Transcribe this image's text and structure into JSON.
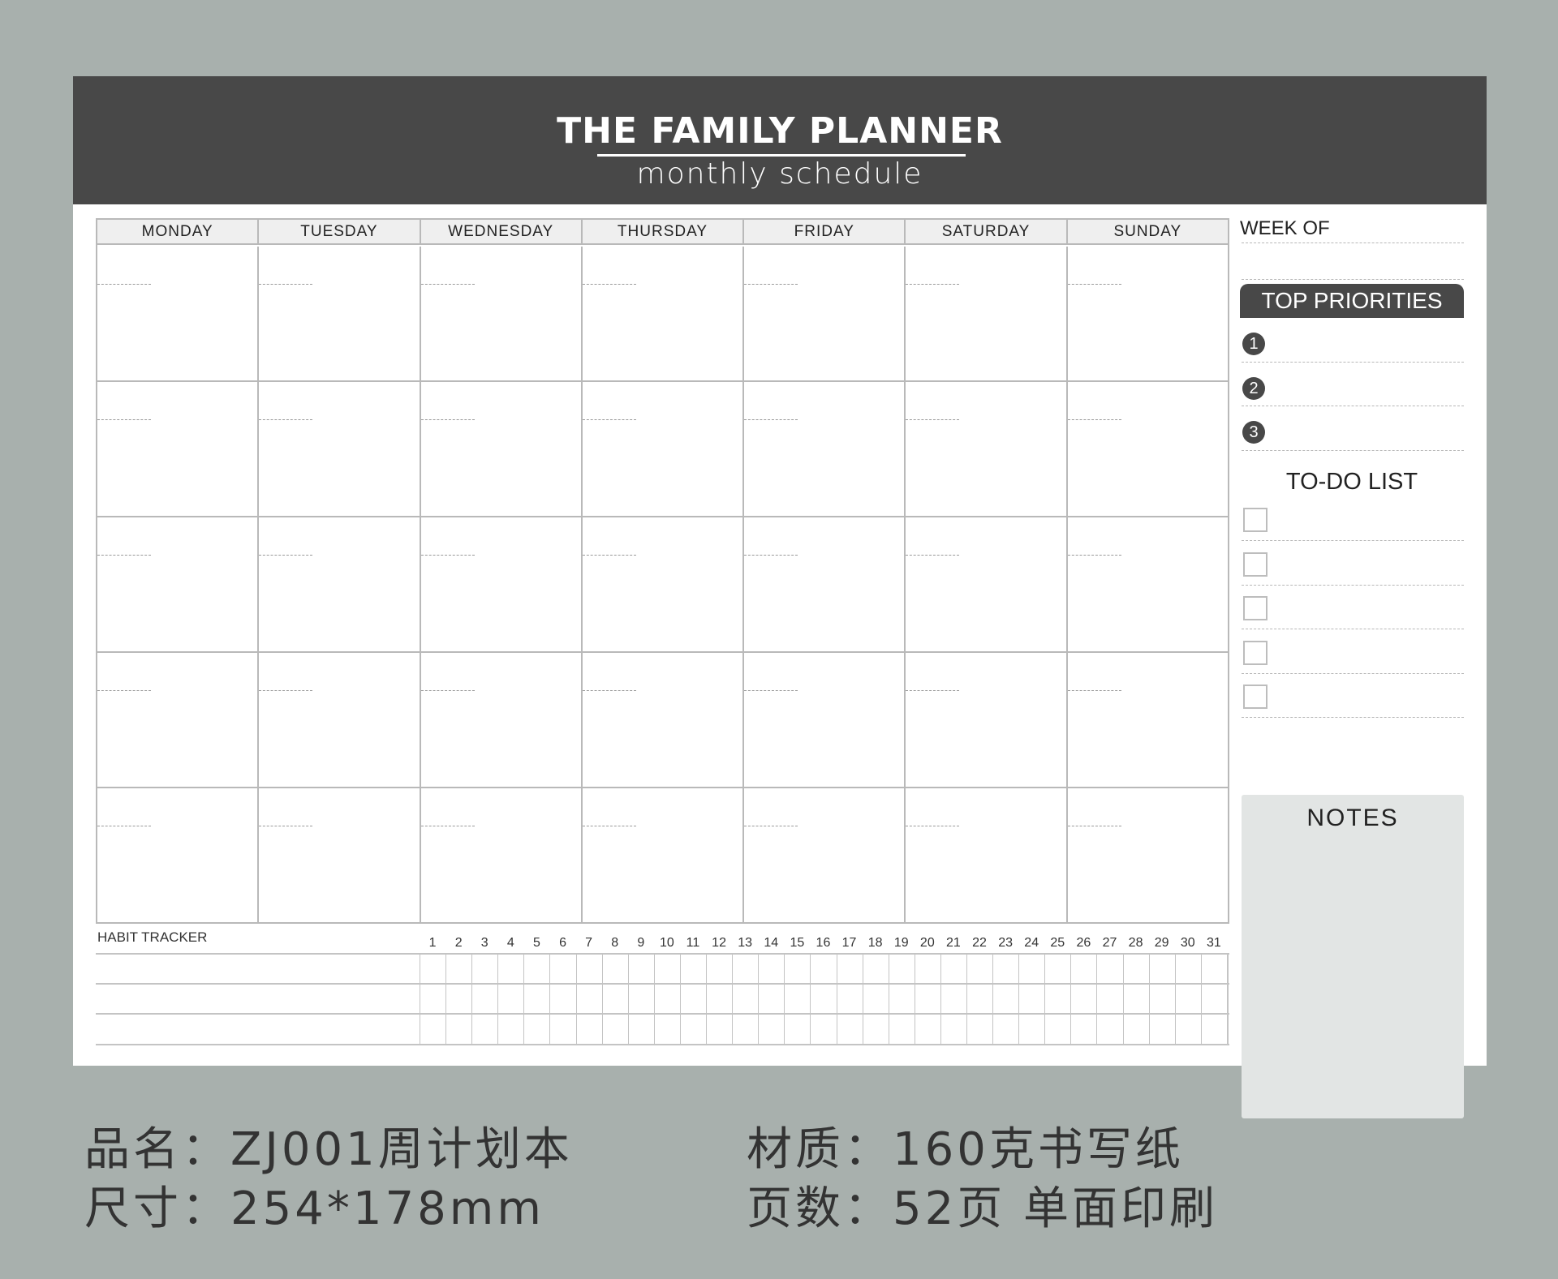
{
  "header": {
    "title": "THE FAMILY PLANNER",
    "subtitle": "monthly schedule",
    "band_color": "#484848"
  },
  "calendar": {
    "days": [
      "MONDAY",
      "TUESDAY",
      "WEDNESDAY",
      "THURSDAY",
      "FRIDAY",
      "SATURDAY",
      "SUNDAY"
    ],
    "weeks": 5
  },
  "habit_tracker": {
    "label": "HABIT TRACKER",
    "days": [
      "1",
      "2",
      "3",
      "4",
      "5",
      "6",
      "7",
      "8",
      "9",
      "10",
      "11",
      "12",
      "13",
      "14",
      "15",
      "16",
      "17",
      "18",
      "19",
      "20",
      "21",
      "22",
      "23",
      "24",
      "25",
      "26",
      "27",
      "28",
      "29",
      "30",
      "31"
    ],
    "rows": 3
  },
  "sidebar": {
    "week_of": "WEEK OF",
    "top_priorities": "TOP PRIORITIES",
    "priorities": [
      "1",
      "2",
      "3"
    ],
    "todo_title": "TO-DO LIST",
    "todo_count": 5,
    "notes_title": "NOTES"
  },
  "specs": {
    "name": "品名：ZJ001周计划本",
    "size": "尺寸：254*178mm",
    "material": "材质：160克书写纸",
    "pages": "页数：52页 单面印刷"
  },
  "colors": {
    "background": "#a8b0ad",
    "page": "#ffffff",
    "dark": "#484848",
    "notes_fill": "#e2e5e4",
    "grid_line": "#b9b9b9"
  }
}
